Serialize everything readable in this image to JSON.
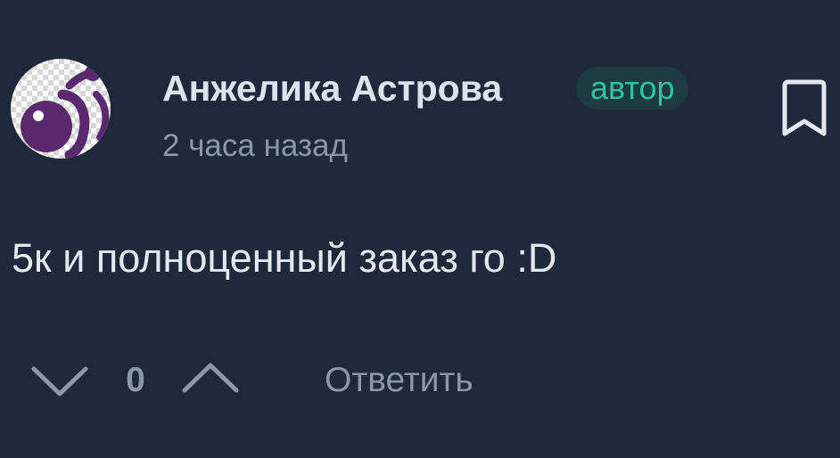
{
  "comment": {
    "author": "Анжелика Астрова",
    "author_badge": "автор",
    "timestamp": "2 часа назад",
    "text": "5к и полноценный заказ го :D",
    "score": "0",
    "reply_label": "Ответить"
  },
  "icons": {
    "avatar": "purple-planet-logo",
    "bookmark": "bookmark-icon",
    "vote_down": "chevron-down-icon",
    "vote_up": "chevron-up-icon"
  },
  "colors": {
    "background": "#1f293b",
    "badge_text": "#2ec4a6",
    "badge_bg": "#1e3a44",
    "avatar_purple": "#5a2a6e",
    "muted_text": "#8b97aa"
  }
}
